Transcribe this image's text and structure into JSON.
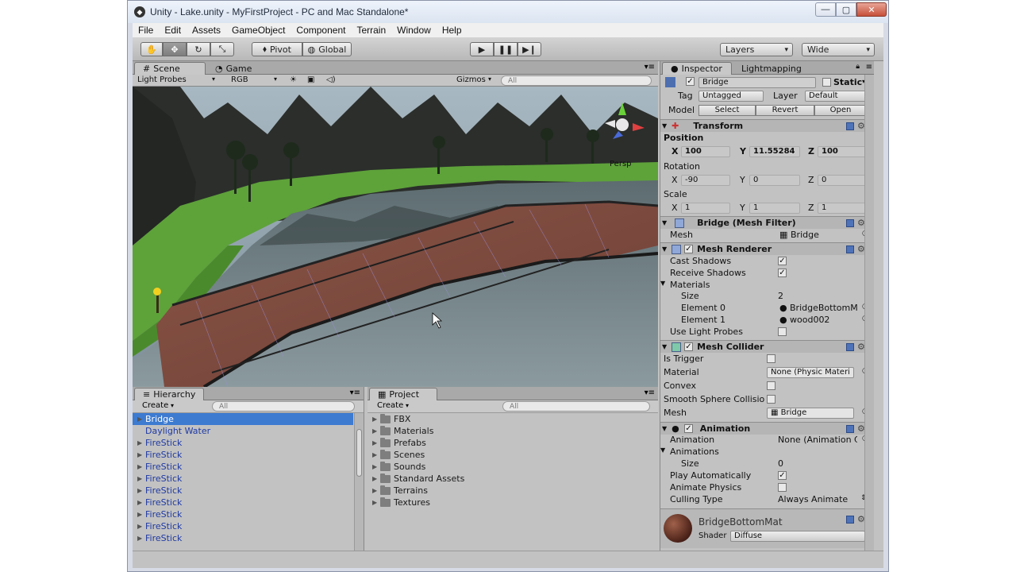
{
  "window": {
    "title": "Unity - Lake.unity - MyFirstProject - PC and Mac Standalone*"
  },
  "menu": [
    "File",
    "Edit",
    "Assets",
    "GameObject",
    "Component",
    "Terrain",
    "Window",
    "Help"
  ],
  "toolbar": {
    "pivot_label": "Pivot",
    "global_label": "Global",
    "layers_label": "Layers",
    "layout_label": "Wide"
  },
  "scene": {
    "tab_scene": "Scene",
    "tab_game": "Game",
    "render_mode": "Light Probes",
    "color_mode": "RGB",
    "gizmos_label": "Gizmos",
    "search_placeholder": "All",
    "persp_label": "Persp"
  },
  "hierarchy": {
    "tab": "Hierarchy",
    "create_label": "Create",
    "search_placeholder": "All",
    "items": [
      {
        "label": "Bridge",
        "selected": true,
        "expandable": true
      },
      {
        "label": "Daylight Water",
        "selected": false,
        "expandable": false
      },
      {
        "label": "FireStick",
        "selected": false,
        "expandable": true
      },
      {
        "label": "FireStick",
        "selected": false,
        "expandable": true
      },
      {
        "label": "FireStick",
        "selected": false,
        "expandable": true
      },
      {
        "label": "FireStick",
        "selected": false,
        "expandable": true
      },
      {
        "label": "FireStick",
        "selected": false,
        "expandable": true
      },
      {
        "label": "FireStick",
        "selected": false,
        "expandable": true
      },
      {
        "label": "FireStick",
        "selected": false,
        "expandable": true
      },
      {
        "label": "FireStick",
        "selected": false,
        "expandable": true
      },
      {
        "label": "FireStick",
        "selected": false,
        "expandable": true
      }
    ]
  },
  "project": {
    "tab": "Project",
    "create_label": "Create",
    "search_placeholder": "All",
    "folders": [
      "FBX",
      "Materials",
      "Prefabs",
      "Scenes",
      "Sounds",
      "Standard Assets",
      "Terrains",
      "Textures"
    ]
  },
  "inspector": {
    "tab_inspector": "Inspector",
    "tab_lightmapping": "Lightmapping",
    "object_name": "Bridge",
    "static_label": "Static",
    "tag_label": "Tag",
    "tag_value": "Untagged",
    "layer_label": "Layer",
    "layer_value": "Default",
    "model_label": "Model",
    "select_label": "Select",
    "revert_label": "Revert",
    "open_label": "Open",
    "transform": {
      "title": "Transform",
      "position_label": "Position",
      "rotation_label": "Rotation",
      "scale_label": "Scale",
      "x_label": "X",
      "y_label": "Y",
      "z_label": "Z",
      "position": [
        "100",
        "11.55284",
        "100"
      ],
      "rotation": [
        "-90",
        "0",
        "0"
      ],
      "scale": [
        "1",
        "1",
        "1"
      ]
    },
    "mesh_filter": {
      "title": "Bridge (Mesh Filter)",
      "mesh_label": "Mesh",
      "mesh_value": "Bridge"
    },
    "mesh_renderer": {
      "title": "Mesh Renderer",
      "cast_shadows": "Cast Shadows",
      "receive_shadows": "Receive Shadows",
      "materials": "Materials",
      "size_label": "Size",
      "size_value": "2",
      "element0_label": "Element 0",
      "element0_value": "BridgeBottomM",
      "element1_label": "Element 1",
      "element1_value": "wood002",
      "light_probes": "Use Light Probes"
    },
    "mesh_collider": {
      "title": "Mesh Collider",
      "is_trigger": "Is Trigger",
      "material_label": "Material",
      "material_value": "None (Physic Materi",
      "convex": "Convex",
      "smooth": "Smooth Sphere Collisio",
      "mesh_label": "Mesh",
      "mesh_value": "Bridge"
    },
    "animation": {
      "title": "Animation",
      "animation_label": "Animation",
      "animation_value": "None (Animation C",
      "animations_label": "Animations",
      "size_label": "Size",
      "size_value": "0",
      "play_auto": "Play Automatically",
      "animate_physics": "Animate Physics",
      "culling_label": "Culling Type",
      "culling_value": "Always Animate"
    },
    "material": {
      "name": "BridgeBottomMat",
      "shader_label": "Shader",
      "shader_value": "Diffuse"
    }
  },
  "colors": {
    "selection": "#3d7bd1",
    "prefab_text": "#1f3aa3",
    "panel_bg": "#c2c2c2"
  }
}
